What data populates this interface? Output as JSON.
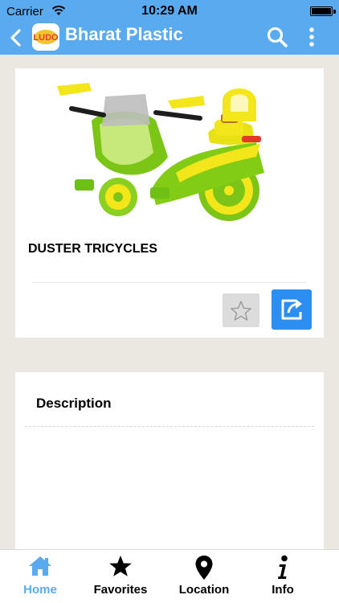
{
  "status_bar": {
    "carrier": "Carrier",
    "time": "10:29 AM",
    "battery_level": 1.0
  },
  "nav": {
    "title": "Bharat Plastic",
    "logo_text": "LUDO"
  },
  "product": {
    "name": "DUSTER TRICYCLES",
    "image_icon": "tricycle-image"
  },
  "description": {
    "title": "Description"
  },
  "tabs": [
    {
      "label": "Home",
      "icon": "home-icon",
      "active": true
    },
    {
      "label": "Favorites",
      "icon": "star-icon",
      "active": false
    },
    {
      "label": "Location",
      "icon": "location-pin-icon",
      "active": false
    },
    {
      "label": "Info",
      "icon": "info-icon",
      "active": false
    }
  ],
  "colors": {
    "accent": "#5aaaf0",
    "share_button": "#2b8ef0",
    "favorite_button": "#dcdcdc",
    "background": "#ebe7e1"
  }
}
